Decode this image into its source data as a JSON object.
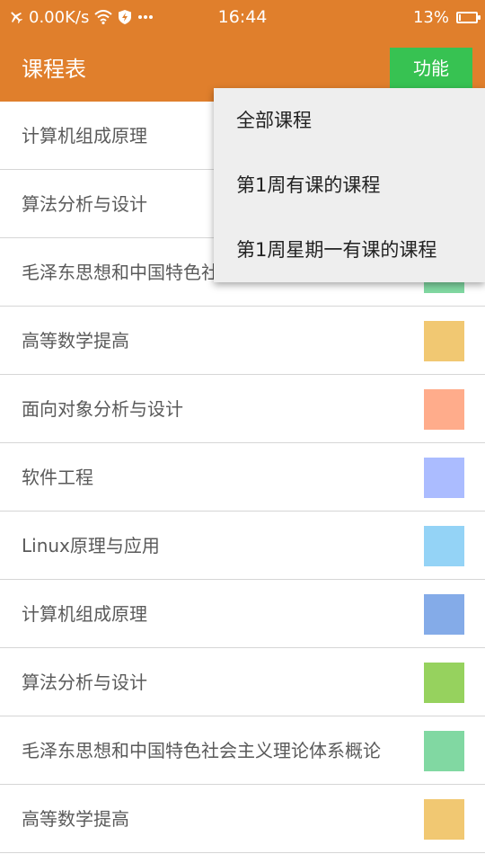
{
  "status_bar": {
    "net_speed": "0.00K/s",
    "time": "16:44",
    "battery": "13%",
    "battery_level": 0.13,
    "icons": [
      "airplane-icon",
      "wifi-icon",
      "shield-icon",
      "more-dots-icon",
      "battery-icon"
    ]
  },
  "app_bar": {
    "title": "课程表",
    "function_button": "功能"
  },
  "menu": {
    "items": [
      "全部课程",
      "第1周有课的课程",
      "第1周星期一有课的课程"
    ]
  },
  "courses": [
    {
      "name": "计算机组成原理",
      "color": "#84abe8"
    },
    {
      "name": "算法分析与设计",
      "color": "#96d25e"
    },
    {
      "name": "毛泽东思想和中国特色社会主义理论体系概论",
      "color": "#81d8a2"
    },
    {
      "name": "高等数学提高",
      "color": "#f1c872"
    },
    {
      "name": "面向对象分析与设计",
      "color": "#ffac8b"
    },
    {
      "name": "软件工程",
      "color": "#abbcff"
    },
    {
      "name": "Linux原理与应用",
      "color": "#94d3f6"
    },
    {
      "name": "计算机组成原理",
      "color": "#84abe8"
    },
    {
      "name": "算法分析与设计",
      "color": "#96d25e"
    },
    {
      "name": "毛泽东思想和中国特色社会主义理论体系概论",
      "color": "#81d8a2"
    },
    {
      "name": "高等数学提高",
      "color": "#f1c872"
    }
  ],
  "colors": {
    "primary": "#e07f2c",
    "button": "#37c252",
    "menu_background": "#eeeeee"
  }
}
